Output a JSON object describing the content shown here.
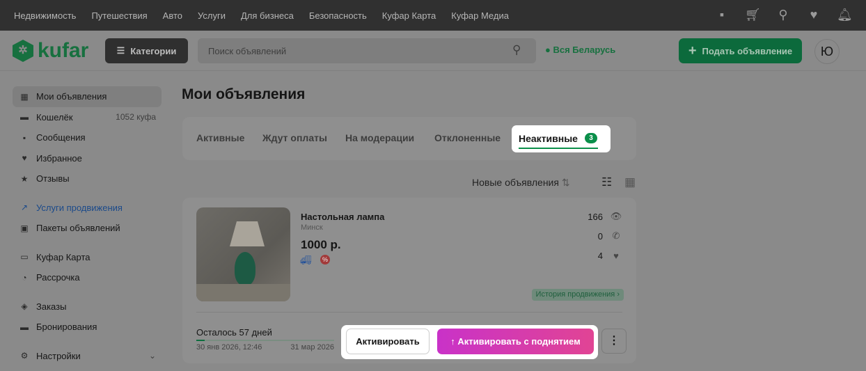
{
  "topnav": [
    "Недвижимость",
    "Путешествия",
    "Авто",
    "Услуги",
    "Для бизнеса",
    "Безопасность",
    "Куфар Карта",
    "Куфар Медиа"
  ],
  "header": {
    "logo": "kufar",
    "categories": "Категории",
    "search_placeholder": "Поиск объявлений",
    "region": "Вся Беларусь",
    "post": "Подать объявление",
    "avatar": "Ю"
  },
  "sidebar": [
    {
      "label": "Мои объявления",
      "icon": "grid-icon"
    },
    {
      "label": "Кошелёк",
      "count": "1052 куфа",
      "icon": "wallet-icon"
    },
    {
      "label": "Сообщения",
      "icon": "chat-icon"
    },
    {
      "label": "Избранное",
      "icon": "heart-icon"
    },
    {
      "label": "Отзывы",
      "icon": "star-icon"
    },
    {
      "label": "Услуги продвижения",
      "icon": "trend-icon"
    },
    {
      "label": "Пакеты объявлений",
      "icon": "package-icon"
    },
    {
      "label": "Куфар Карта",
      "icon": "card-icon"
    },
    {
      "label": "Рассрочка",
      "icon": "installment-icon"
    },
    {
      "label": "Заказы",
      "icon": "box-icon"
    },
    {
      "label": "Бронирования",
      "icon": "bed-icon"
    },
    {
      "label": "Настройки",
      "icon": "gear-icon"
    }
  ],
  "page_title": "Мои объявления",
  "tabs": [
    "Активные",
    "Ждут оплаты",
    "На модерации",
    "Отклоненные"
  ],
  "active_tab": {
    "label": "Неактивные",
    "count": "3"
  },
  "sort": "Новые объявления",
  "listing": {
    "title": "Настольная лампа",
    "city": "Минск",
    "price": "1000 р.",
    "views": "166",
    "calls": "0",
    "favorites": "4",
    "history": "История продвижения",
    "remaining": "Осталось 57 дней",
    "progress": 0.06,
    "start": "30 янв 2026, 12:46",
    "end": "31 мар 2026",
    "activate": "Активировать",
    "activate_boost": "Активировать с поднятием"
  }
}
